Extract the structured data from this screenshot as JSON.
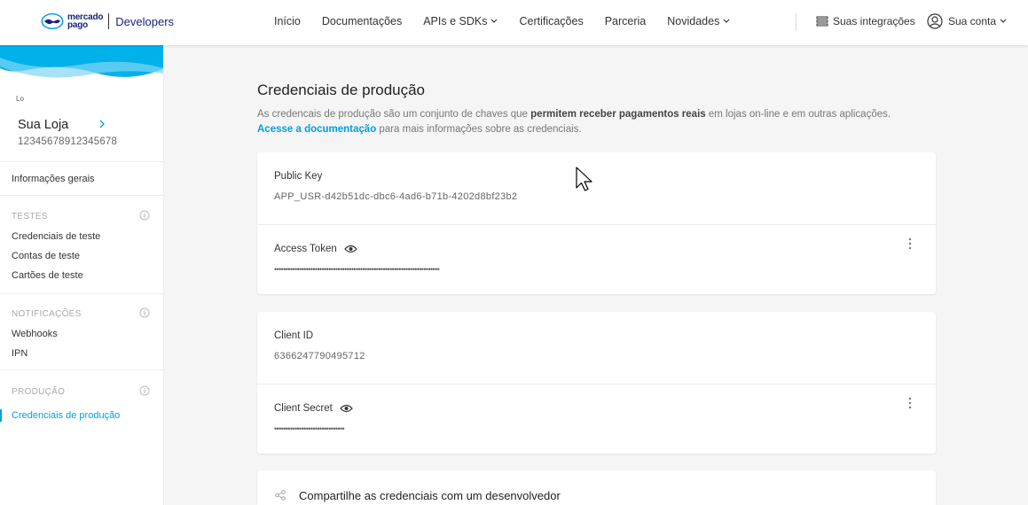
{
  "header": {
    "brand_line1": "mercado",
    "brand_line2": "pago",
    "brand_suffix": "Developers",
    "nav": [
      {
        "label": "Início",
        "has_dropdown": false
      },
      {
        "label": "Documentações",
        "has_dropdown": false
      },
      {
        "label": "APIs e SDKs",
        "has_dropdown": true
      },
      {
        "label": "Certificações",
        "has_dropdown": false
      },
      {
        "label": "Parceria",
        "has_dropdown": false
      },
      {
        "label": "Novidades",
        "has_dropdown": true
      }
    ],
    "integrations_label": "Suas integrações",
    "account_label": "Sua conta"
  },
  "sidebar": {
    "store_badge": "Lo",
    "store_name": "Sua Loja",
    "store_id": "12345678912345678",
    "general_info": "Informações gerais",
    "sections": [
      {
        "title": "TESTES",
        "items": [
          "Credenciais de teste",
          "Contas de teste",
          "Cartões de teste"
        ]
      },
      {
        "title": "NOTIFICAÇÕES",
        "items": [
          "Webhooks",
          "IPN"
        ]
      },
      {
        "title": "PRODUÇÃO",
        "items": [
          "Credenciais de produção"
        ]
      }
    ],
    "active_item": "Credenciais de produção"
  },
  "main": {
    "title": "Credenciais de produção",
    "desc_part1": "As credencais de produção são um conjunto de chaves que ",
    "desc_bold": "permitem receber pagamentos reais",
    "desc_part2": " em lojas on-line e em outras aplicações.",
    "desc_link": "Acesse a documentação",
    "desc_part3": " para mais informações sobre as credenciais.",
    "card1": {
      "public_key_label": "Public Key",
      "public_key_value": "APP_USR-d42b51dc-dbc6-4ad6-b71b-4202d8bf23b2",
      "access_token_label": "Access Token",
      "access_token_masked": "•••••••••••••••••••••••••••••••••••••••••••••••••••••••••••••••••••••••••"
    },
    "card2": {
      "client_id_label": "Client ID",
      "client_id_value": "6366247790495712",
      "client_secret_label": "Client Secret",
      "client_secret_masked": "•••••••••••••••••••••••••••••••"
    },
    "share_title": "Compartilhe as credenciais com um desenvolvedor"
  },
  "colors": {
    "accent": "#009ee3",
    "brand_navy": "#1a237e",
    "wave_blue": "#00b1ea"
  },
  "icons": [
    "handshake-logo-icon",
    "chevron-down-icon",
    "list-icon",
    "user-circle-icon",
    "chevron-right-icon",
    "info-icon",
    "eye-icon",
    "kebab-menu-icon",
    "share-icon",
    "mouse-cursor-icon"
  ]
}
